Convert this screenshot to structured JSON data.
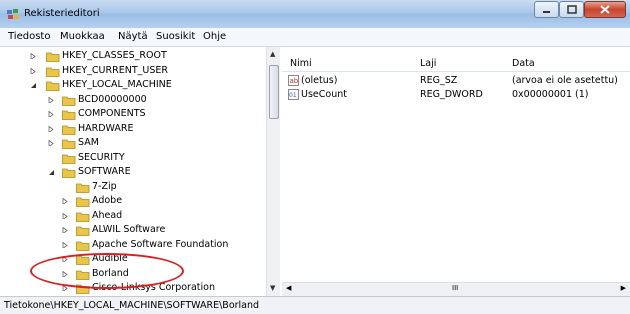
{
  "window": {
    "title": "Rekisterieditori"
  },
  "menu": [
    {
      "label": "Tiedosto"
    },
    {
      "label": "Muokkaa"
    },
    {
      "label": "Näytä"
    },
    {
      "label": "Suosikit"
    },
    {
      "label": "Ohje"
    }
  ],
  "tree": [
    {
      "label": "HKEY_CLASSES_ROOT",
      "level": 1,
      "state": "collapsed"
    },
    {
      "label": "HKEY_CURRENT_USER",
      "level": 1,
      "state": "collapsed"
    },
    {
      "label": "HKEY_LOCAL_MACHINE",
      "level": 1,
      "state": "expanded"
    },
    {
      "label": "BCD00000000",
      "level": 2,
      "state": "collapsed"
    },
    {
      "label": "COMPONENTS",
      "level": 2,
      "state": "collapsed"
    },
    {
      "label": "HARDWARE",
      "level": 2,
      "state": "collapsed"
    },
    {
      "label": "SAM",
      "level": 2,
      "state": "collapsed"
    },
    {
      "label": "SECURITY",
      "level": 2,
      "state": "none"
    },
    {
      "label": "SOFTWARE",
      "level": 2,
      "state": "expanded"
    },
    {
      "label": "7-Zip",
      "level": 3,
      "state": "none"
    },
    {
      "label": "Adobe",
      "level": 3,
      "state": "collapsed"
    },
    {
      "label": "Ahead",
      "level": 3,
      "state": "collapsed"
    },
    {
      "label": "ALWIL Software",
      "level": 3,
      "state": "collapsed"
    },
    {
      "label": "Apache Software Foundation",
      "level": 3,
      "state": "collapsed"
    },
    {
      "label": "Audible",
      "level": 3,
      "state": "collapsed"
    },
    {
      "label": "Borland",
      "level": 3,
      "state": "collapsed",
      "selected": true
    },
    {
      "label": "Cisco-Linksys Corporation",
      "level": 3,
      "state": "collapsed"
    }
  ],
  "list": {
    "headers": [
      "Nimi",
      "Laji",
      "Data"
    ],
    "rows": [
      {
        "name": "(oletus)",
        "type": "REG_SZ",
        "data": "(arvoa ei ole asetettu)",
        "icon": "string-value-icon"
      },
      {
        "name": "UseCount",
        "type": "REG_DWORD",
        "data": "0x00000001 (1)",
        "icon": "binary-value-icon"
      }
    ]
  },
  "status": "Tietokone\\HKEY_LOCAL_MACHINE\\SOFTWARE\\Borland",
  "scroll": {
    "hscroll_arrow_label": "III"
  },
  "colors": {
    "folder": "#e8c64a",
    "highlight": "#d62020"
  }
}
